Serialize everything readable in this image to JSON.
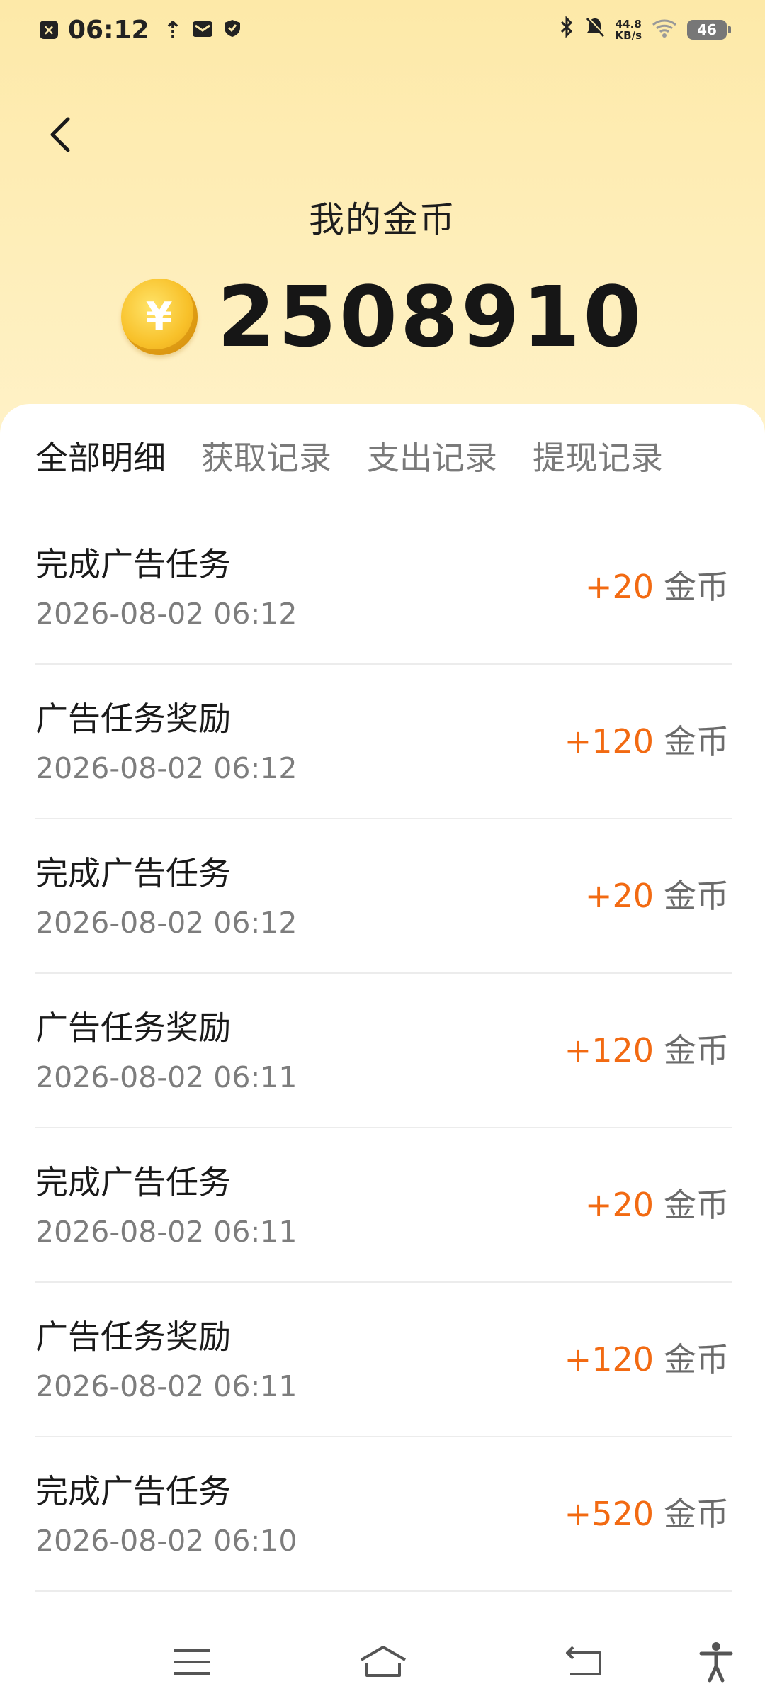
{
  "status_bar": {
    "time": "06:12",
    "net_speed_value": "44.8",
    "net_speed_unit": "KB/s",
    "battery": "46"
  },
  "header": {
    "title": "我的金币",
    "balance": "2508910"
  },
  "tabs": [
    {
      "label": "全部明细",
      "active": true
    },
    {
      "label": "获取记录",
      "active": false
    },
    {
      "label": "支出记录",
      "active": false
    },
    {
      "label": "提现记录",
      "active": false
    }
  ],
  "records": [
    {
      "title": "完成广告任务",
      "time": "2026-08-02 06:12",
      "amount": "+20",
      "unit": "金币"
    },
    {
      "title": "广告任务奖励",
      "time": "2026-08-02 06:12",
      "amount": "+120",
      "unit": "金币"
    },
    {
      "title": "完成广告任务",
      "time": "2026-08-02 06:12",
      "amount": "+20",
      "unit": "金币"
    },
    {
      "title": "广告任务奖励",
      "time": "2026-08-02 06:11",
      "amount": "+120",
      "unit": "金币"
    },
    {
      "title": "完成广告任务",
      "time": "2026-08-02 06:11",
      "amount": "+20",
      "unit": "金币"
    },
    {
      "title": "广告任务奖励",
      "time": "2026-08-02 06:11",
      "amount": "+120",
      "unit": "金币"
    },
    {
      "title": "完成广告任务",
      "time": "2026-08-02 06:10",
      "amount": "+520",
      "unit": "金币"
    }
  ],
  "colors": {
    "header_bg": "#fde9a8",
    "amount": "#f26a12",
    "primary_text": "#1a1a1a",
    "secondary_text": "#7d7d7d"
  },
  "icons": {
    "back": "chevron-left-icon",
    "coin": "yuan-coin-icon",
    "nav_menu": "menu-icon",
    "nav_home": "home-icon",
    "nav_back": "return-icon",
    "nav_accessibility": "accessibility-icon"
  }
}
